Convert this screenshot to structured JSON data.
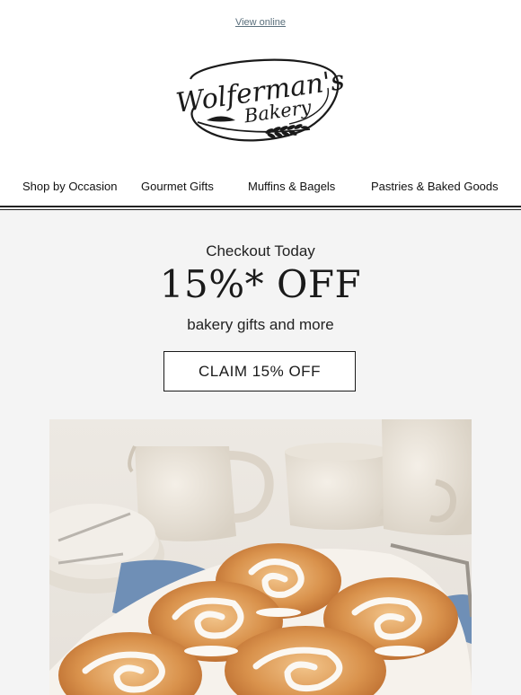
{
  "header": {
    "view_online": "View online",
    "logo_line1": "Wolferman's",
    "logo_line2": "Bakery"
  },
  "nav": {
    "items": [
      {
        "label": "Shop by Occasion"
      },
      {
        "label": "Gourmet Gifts"
      },
      {
        "label": "Muffins & Bagels"
      },
      {
        "label": "Pastries & Baked Goods"
      }
    ]
  },
  "promo": {
    "kicker": "Checkout Today",
    "headline": "15%* OFF",
    "subline": "bakery gifts and more",
    "cta_label": "CLAIM 15% OFF"
  },
  "colors": {
    "promo_bg": "#f4f4f4",
    "link": "#5a6f7c",
    "ink": "#1a1a1a"
  }
}
